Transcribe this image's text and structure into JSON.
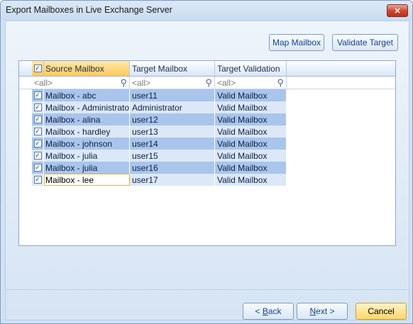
{
  "window": {
    "title": "Export Mailboxes in Live Exchange Server",
    "close_label": "✕"
  },
  "toolbar": {
    "map_label": "Map Mailbox",
    "validate_label": "Validate Target"
  },
  "grid": {
    "headers": {
      "check": "✓",
      "source": "Source Mailbox",
      "target": "Target Mailbox",
      "validation": "Target Validation"
    },
    "filter_placeholder": "<all>",
    "rows": [
      {
        "checked": "✓",
        "source": "Mailbox - abc",
        "target": "user11",
        "validation": "Valid Mailbox"
      },
      {
        "checked": "✓",
        "source": "Mailbox - Administrator",
        "target": "Administrator",
        "validation": "Valid Mailbox"
      },
      {
        "checked": "✓",
        "source": "Mailbox - alina",
        "target": "user12",
        "validation": "Valid Mailbox"
      },
      {
        "checked": "✓",
        "source": "Mailbox - hardley",
        "target": "user13",
        "validation": "Valid Mailbox"
      },
      {
        "checked": "✓",
        "source": "Mailbox - johnson",
        "target": "user14",
        "validation": "Valid Mailbox"
      },
      {
        "checked": "✓",
        "source": "Mailbox - julia",
        "target": "user15",
        "validation": "Valid Mailbox"
      },
      {
        "checked": "✓",
        "source": "Mailbox - julia",
        "target": "user16",
        "validation": "Valid Mailbox"
      },
      {
        "checked": "✓",
        "source": "Mailbox - lee",
        "target": "user17",
        "validation": "Valid Mailbox"
      }
    ]
  },
  "footer": {
    "back_prefix": "< ",
    "back_key": "B",
    "back_rest": "ack",
    "next_key": "N",
    "next_rest": "ext >",
    "cancel_label": "Cancel"
  },
  "colors": {
    "accent": "#15428b",
    "row_dark": "#a9c5ec",
    "row_light": "#dce8f8",
    "cancel": "#ffd76a"
  }
}
